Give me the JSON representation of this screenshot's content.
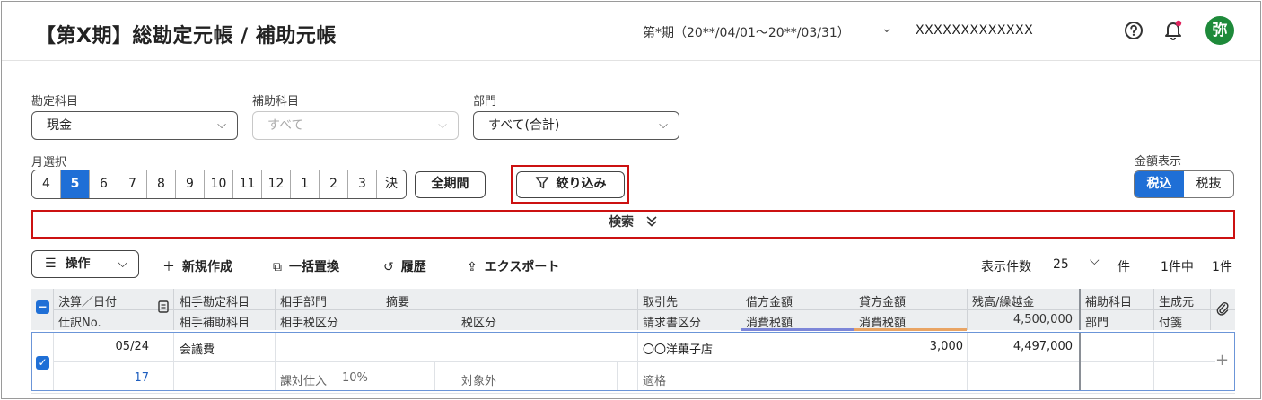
{
  "header": {
    "title": "【第X期】総勘定元帳 / 補助元帳",
    "period": "第*期（20**/04/01〜20**/03/31）",
    "company": "XXXXXXXXXXXXX",
    "avatar": "弥",
    "avatar_color": "#1e8a3a"
  },
  "filters": {
    "account_label": "勘定科目",
    "account_value": "現金",
    "sub_account_label": "補助科目",
    "sub_account_value": "すべて",
    "dept_label": "部門",
    "dept_value": "すべて(合計)",
    "month_label": "月選択",
    "months": [
      "4",
      "5",
      "6",
      "7",
      "8",
      "9",
      "10",
      "11",
      "12",
      "1",
      "2",
      "3",
      "決"
    ],
    "active_month": "5",
    "all_period": "全期間",
    "narrow": "絞り込み",
    "amount_label": "金額表示",
    "tax_in": "税込",
    "tax_out": "税抜"
  },
  "search": {
    "label": "検索"
  },
  "toolbar": {
    "operations": "操作",
    "new": "新規作成",
    "bulk_replace": "一括置換",
    "history": "履歴",
    "export": "エクスポート",
    "display_count_label": "表示件数",
    "display_count": "25",
    "unit": "件",
    "count_text": "1件中",
    "count_total": "1件"
  },
  "table": {
    "headers": {
      "date": "決算／日付",
      "entry_no": "仕訳No.",
      "counter_account": "相手勘定科目",
      "counter_sub": "相手補助科目",
      "counter_dept": "相手部門",
      "counter_tax": "相手税区分",
      "summary": "摘要",
      "tax_class": "税区分",
      "partner": "取引先",
      "invoice_class": "請求書区分",
      "debit": "借方金額",
      "debit_tax": "消費税額",
      "credit": "貸方金額",
      "credit_tax": "消費税額",
      "balance": "残高/繰越金",
      "carryover": "4,500,000",
      "sub_account": "補助科目",
      "dept": "部門",
      "source": "生成元",
      "tag": "付箋"
    },
    "rows": [
      {
        "date": "05/24",
        "entry_no": "17",
        "counter_account": "会議費",
        "counter_tax": "課対仕入",
        "counter_tax_rate": "10%",
        "tax_class": "対象外",
        "partner": "〇〇洋菓子店",
        "invoice_class": "適格",
        "credit": "3,000",
        "balance": "4,497,000"
      }
    ]
  },
  "colors": {
    "accent": "#1f6fd6",
    "highlight": "#cc1111"
  }
}
